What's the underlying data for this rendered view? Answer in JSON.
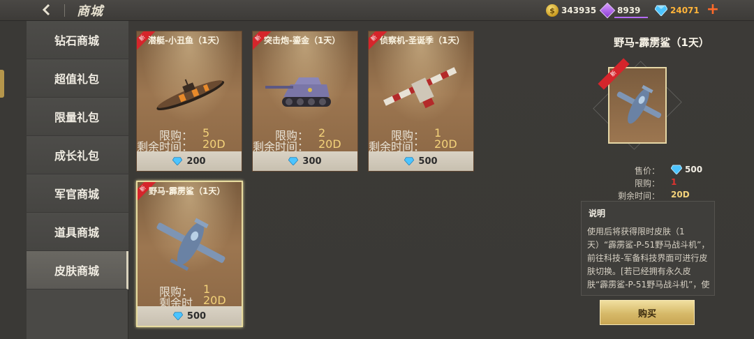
{
  "header": {
    "title": "商城",
    "gold": "343935",
    "gems": "8939",
    "diamonds": "24071"
  },
  "sidebar": {
    "items": [
      {
        "label": "钻石商城"
      },
      {
        "label": "超值礼包"
      },
      {
        "label": "限量礼包"
      },
      {
        "label": "成长礼包"
      },
      {
        "label": "军官商城"
      },
      {
        "label": "道具商城"
      },
      {
        "label": "皮肤商城"
      }
    ]
  },
  "cards": [
    {
      "name": "潜艇-小丑鱼（1天）",
      "limit_label": "限购：",
      "limit": "5",
      "time_label": "剩余时间：",
      "time": "20D",
      "price": "200",
      "new_badge": "新"
    },
    {
      "name": "突击炮-鎏金（1天）",
      "limit_label": "限购：",
      "limit": "2",
      "time_label": "剩余时间：",
      "time": "20D",
      "price": "300",
      "new_badge": "新"
    },
    {
      "name": "侦察机-圣诞季（1天）",
      "limit_label": "限购：",
      "limit": "1",
      "time_label": "剩余时间：",
      "time": "20D",
      "price": "500",
      "new_badge": "新"
    },
    {
      "name": "野马-霹雳鲨（1天）",
      "limit_label": "限购：",
      "limit": "1",
      "time_label": "剩余时间：",
      "time": "20D",
      "price": "500",
      "new_badge": "新"
    }
  ],
  "detail": {
    "title": "野马-霹雳鲨（1天）",
    "price_label": "售价：",
    "price": "500",
    "limit_label": "限购：",
    "limit": "1",
    "time_label": "剩余时间：",
    "time": "20D",
    "desc_title": "说明",
    "desc": "使用后将获得限时皮肤（1天）“霹雳鲨-P-51野马战斗机”，前往科技-军备科技界面可进行皮肤切换。[若已经拥有永久皮肤“霹雳鲨-P-51野马战斗机”，使用该道具将",
    "buy_label": "购买",
    "new_badge": "新"
  }
}
